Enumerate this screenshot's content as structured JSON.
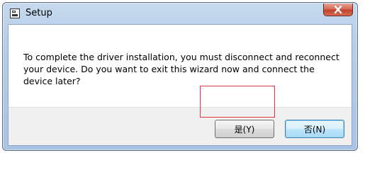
{
  "window": {
    "title": "Setup",
    "close_icon": "close-x-icon",
    "app_icon": "setup-window-icon"
  },
  "dialog": {
    "message": "To complete the driver installation, you must disconnect and reconnect your device. Do you want to exit this wizard now and connect the device later?"
  },
  "buttons": {
    "yes_label": "是(Y)",
    "no_label": "否(N)"
  },
  "colors": {
    "highlight_border": "#e0383b",
    "close_button": "#c1412b",
    "titlebar": "#b6cde8"
  }
}
